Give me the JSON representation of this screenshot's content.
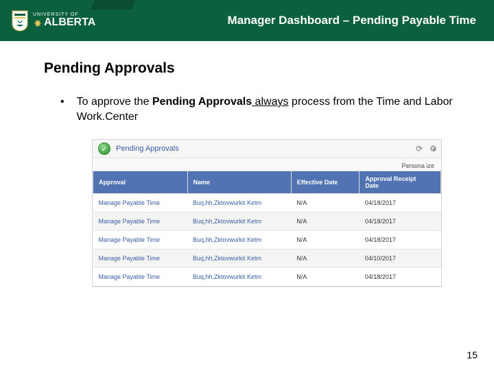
{
  "logo": {
    "top": "UNIVERSITY OF",
    "bottom": "ALBERTA"
  },
  "slide_title": "Manager Dashboard – Pending Payable Time",
  "heading": "Pending Approvals",
  "bullet": {
    "pre": "To approve the ",
    "bold": "Pending Approvals",
    "underline": " always",
    "post": " process from the Time and Labor Work.Center"
  },
  "panel": {
    "title": "Pending Approvals",
    "personalize": "Persona ize",
    "columns": {
      "approval": "Approval",
      "name": "Name",
      "effective": "Effective Date",
      "receipt_l1": "Approval Receipt",
      "receipt_l2": "Date"
    },
    "rows": [
      {
        "approval": "Manage Payable Time",
        "name": "Buq,hh,Zktovwurkit Ketm",
        "effective": "N/A",
        "receipt": "04/18/2017"
      },
      {
        "approval": "Manage Payable Time",
        "name": "Buq,hh,Zktovwurkit Ketm",
        "effective": "N/A",
        "receipt": "04/18/2017"
      },
      {
        "approval": "Manage Payable Time",
        "name": "Buq,hh,Zktovwurkit Ketm",
        "effective": "N/A",
        "receipt": "04/18/2017"
      },
      {
        "approval": "Manage Payable Time",
        "name": "Buq,hh,Zktovwurkit Ketm",
        "effective": "N/A",
        "receipt": "04/10/2017"
      },
      {
        "approval": "Manage Payable Time",
        "name": "Buq,hh,Zktovwurkit Ketm",
        "effective": "N/A",
        "receipt": "04/18/2017"
      }
    ]
  },
  "page_number": "15"
}
